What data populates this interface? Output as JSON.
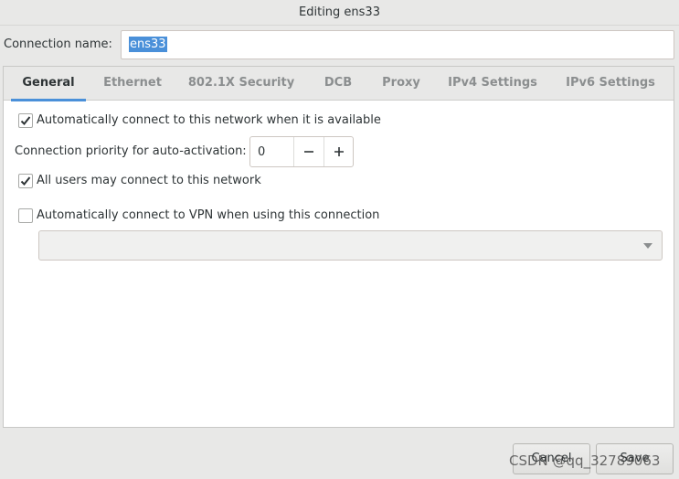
{
  "window": {
    "title": "Editing ens33"
  },
  "connection": {
    "label": "Connection name:",
    "value": "ens33"
  },
  "tabs": [
    {
      "label": "General",
      "active": true
    },
    {
      "label": "Ethernet",
      "active": false
    },
    {
      "label": "802.1X Security",
      "active": false
    },
    {
      "label": "DCB",
      "active": false
    },
    {
      "label": "Proxy",
      "active": false
    },
    {
      "label": "IPv4 Settings",
      "active": false
    },
    {
      "label": "IPv6 Settings",
      "active": false
    }
  ],
  "general": {
    "auto_connect": {
      "label": "Automatically connect to this network when it is available",
      "checked": true
    },
    "priority": {
      "label": "Connection priority for auto-activation:",
      "value": "0",
      "decrement": "−",
      "increment": "+"
    },
    "all_users": {
      "label": "All users may connect to this network",
      "checked": true
    },
    "auto_vpn": {
      "label": "Automatically connect to VPN when using this connection",
      "checked": false
    },
    "vpn_select": {
      "value": "",
      "icon": "chevron-down-icon"
    }
  },
  "buttons": {
    "cancel": "Cancel",
    "save": "Save"
  },
  "watermark": "CSDN @qq_32789063",
  "colors": {
    "accent": "#4a90d9",
    "text": "#2e3436",
    "inactive_tab": "#8b8e8f"
  }
}
